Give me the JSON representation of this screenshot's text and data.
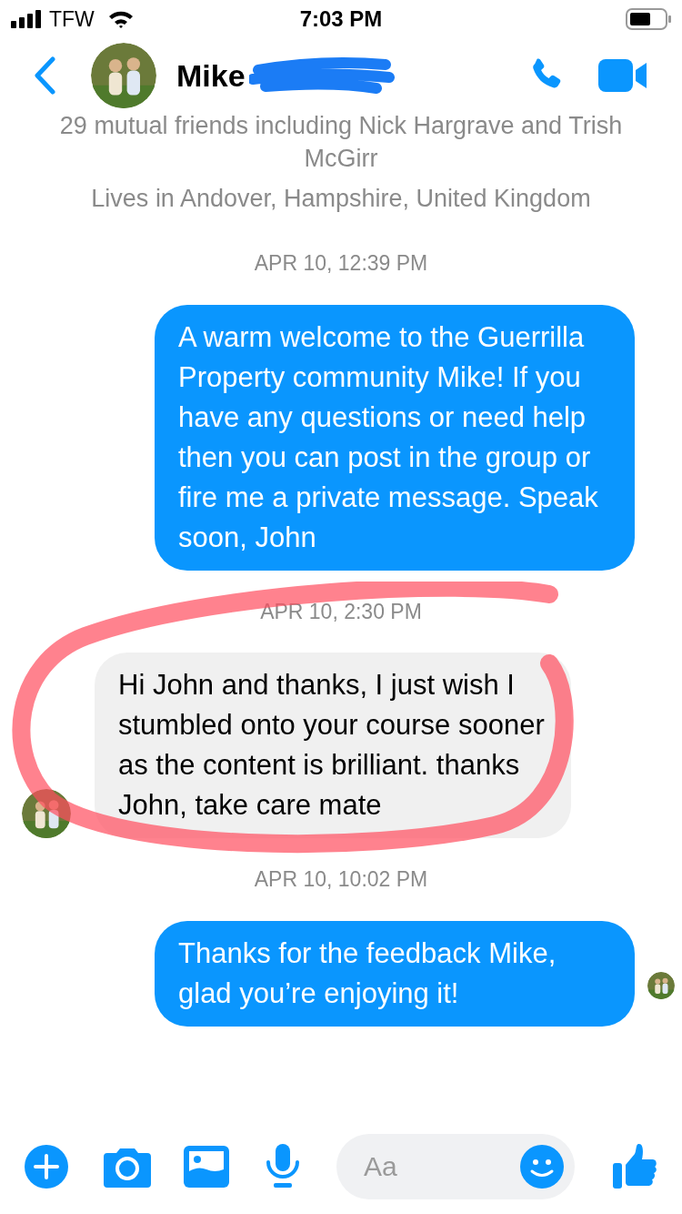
{
  "status_bar": {
    "carrier": "TFW",
    "time": "7:03 PM"
  },
  "header": {
    "name": "Mike"
  },
  "profile_info": {
    "mutual": "29 mutual friends including Nick Hargrave and Trish McGirr",
    "location": "Lives in Andover, Hampshire, United Kingdom"
  },
  "messages": [
    {
      "kind": "timestamp",
      "text": "APR 10, 12:39 PM"
    },
    {
      "kind": "sent",
      "text": "A warm welcome to the Guerrilla Property community Mike! If you have any questions or need help then you can post in the group or fire me a private message. Speak soon, John"
    },
    {
      "kind": "timestamp",
      "text": "APR 10, 2:30 PM"
    },
    {
      "kind": "received",
      "text": "Hi John and thanks, I just wish I stumbled onto your course sooner as the content is brilliant. thanks John, take care mate"
    },
    {
      "kind": "timestamp",
      "text": "APR 10, 10:02 PM"
    },
    {
      "kind": "sent",
      "text": "Thanks for the feedback Mike, glad you’re enjoying it!",
      "seen": true
    }
  ],
  "composer": {
    "placeholder": "Aa"
  }
}
